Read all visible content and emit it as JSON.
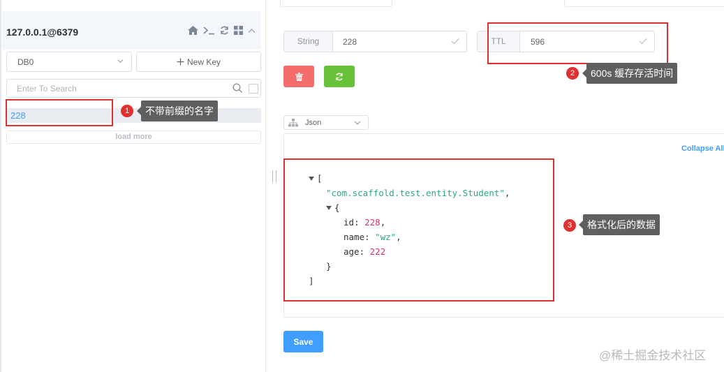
{
  "connection": {
    "title": "127.0.0.1@6379",
    "icons": [
      "home-icon",
      "terminal-icon",
      "refresh-icon",
      "grid-icon",
      "chevron-up-icon"
    ]
  },
  "db_select": {
    "value": "DB0"
  },
  "new_key": {
    "label": "New Key",
    "icon": "plus-icon"
  },
  "search": {
    "placeholder": "Enter To Search"
  },
  "keys": [
    {
      "name": "228"
    }
  ],
  "load_more": "load more",
  "key_type": {
    "label": "String",
    "value": "228"
  },
  "ttl": {
    "label": "TTL",
    "value": "596"
  },
  "format_select": {
    "value": "Json"
  },
  "collapse_all": "Collapse All",
  "json_view": {
    "open_bracket": "[",
    "class_string": "\"com.scaffold.test.entity.Student\"",
    "comma": ",",
    "open_brace": "{",
    "fields": [
      {
        "key": "id",
        "value": "228",
        "kind": "number"
      },
      {
        "key": "name",
        "value": "\"wz\"",
        "kind": "string"
      },
      {
        "key": "age",
        "value": "222",
        "kind": "number"
      }
    ],
    "close_brace": "}",
    "close_bracket": "]"
  },
  "save_button": "Save",
  "annotations": [
    {
      "number": "1",
      "text": "不带前缀的名字"
    },
    {
      "number": "2",
      "text": "600s 缓存存活时间"
    },
    {
      "number": "3",
      "text": "格式化后的数据"
    }
  ],
  "watermark": "@稀土掘金技术社区",
  "colors": {
    "accent": "#409eff",
    "danger": "#f56c6c",
    "success": "#67c23a",
    "annotation_red": "#e03131",
    "string_green": "#2aa87a",
    "number_pink": "#d6336c"
  }
}
